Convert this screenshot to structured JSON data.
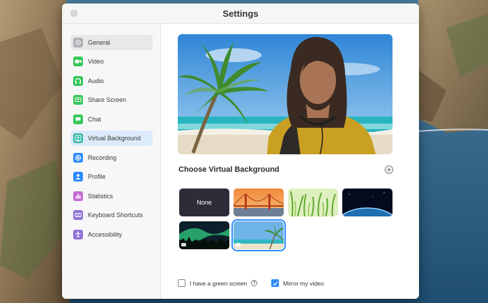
{
  "window": {
    "title": "Settings"
  },
  "sidebar": {
    "items": [
      {
        "label": "General",
        "icon": "gear-icon",
        "color": "#8e8e93"
      },
      {
        "label": "Video",
        "icon": "camera-icon",
        "color": "#34c759"
      },
      {
        "label": "Audio",
        "icon": "headphones-icon",
        "color": "#34c759"
      },
      {
        "label": "Share Screen",
        "icon": "share-screen-icon",
        "color": "#34c759"
      },
      {
        "label": "Chat",
        "icon": "chat-icon",
        "color": "#34c759"
      },
      {
        "label": "Virtual Background",
        "icon": "person-icon",
        "color": "#34b8a3"
      },
      {
        "label": "Recording",
        "icon": "record-icon",
        "color": "#2d8cff"
      },
      {
        "label": "Profile",
        "icon": "profile-icon",
        "color": "#2d8cff"
      },
      {
        "label": "Statistics",
        "icon": "bar-chart-icon",
        "color": "#c56bd6"
      },
      {
        "label": "Keyboard Shortcuts",
        "icon": "keyboard-icon",
        "color": "#8e72d6"
      },
      {
        "label": "Accessibility",
        "icon": "accessibility-icon",
        "color": "#8e72d6"
      }
    ],
    "selected_index": 0,
    "active_index": 5
  },
  "main": {
    "section_title": "Choose Virtual Background",
    "backgrounds": [
      {
        "label": "None",
        "kind": "none"
      },
      {
        "label": "",
        "kind": "golden-gate-bridge"
      },
      {
        "label": "",
        "kind": "grass"
      },
      {
        "label": "",
        "kind": "earth-from-space"
      },
      {
        "label": "",
        "kind": "aurora"
      },
      {
        "label": "",
        "kind": "beach"
      }
    ],
    "selected_background_index": 5,
    "green_screen": {
      "label": "I have a green screen",
      "checked": false
    },
    "mirror_video": {
      "label": "Mirror my video",
      "checked": true
    }
  },
  "colors": {
    "accent": "#2d8cff",
    "selection": "#dcebf9"
  }
}
